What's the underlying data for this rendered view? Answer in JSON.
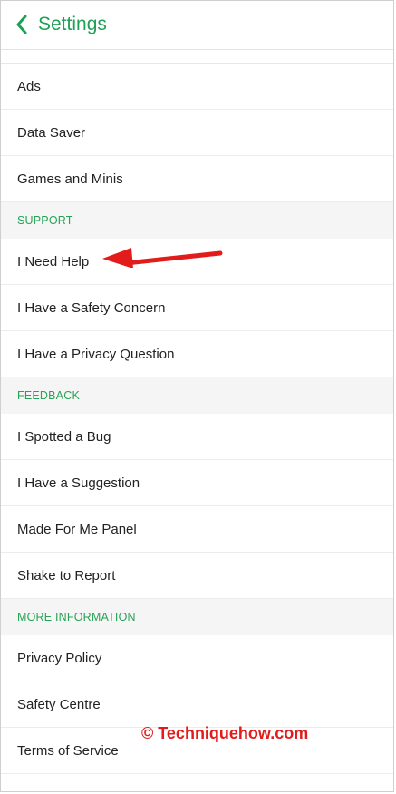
{
  "header": {
    "title": "Settings",
    "back_icon": "chevron-left-icon"
  },
  "sections": [
    {
      "id": "general",
      "header": "",
      "items": [
        "Ads",
        "Data Saver",
        "Games and Minis"
      ]
    },
    {
      "id": "support",
      "header": "SUPPORT",
      "items": [
        "I Need Help",
        "I Have a Safety Concern",
        "I Have a Privacy Question"
      ]
    },
    {
      "id": "feedback",
      "header": "FEEDBACK",
      "items": [
        "I Spotted a Bug",
        "I Have a Suggestion",
        "Made For Me Panel",
        "Shake to Report"
      ]
    },
    {
      "id": "more-info",
      "header": "MORE INFORMATION",
      "items": [
        "Privacy Policy",
        "Safety Centre",
        "Terms of Service"
      ]
    }
  ],
  "annotation": {
    "arrow_target": "I Need Help",
    "arrow_color": "#e21b1b"
  },
  "watermark": "© Techniquehow.com",
  "colors": {
    "accent": "#1fa155",
    "section_bg": "#f5f5f5"
  }
}
